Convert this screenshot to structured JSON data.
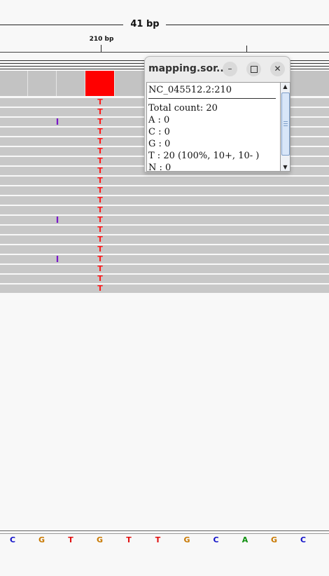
{
  "ruler": {
    "span_label": "41 bp",
    "position_label": "210 bp"
  },
  "reads": [
    {
      "base": "T",
      "insertion": ""
    },
    {
      "base": "T",
      "insertion": ""
    },
    {
      "base": "T",
      "insertion": "I"
    },
    {
      "base": "T",
      "insertion": ""
    },
    {
      "base": "T",
      "insertion": ""
    },
    {
      "base": "T",
      "insertion": ""
    },
    {
      "base": "T",
      "insertion": ""
    },
    {
      "base": "T",
      "insertion": ""
    },
    {
      "base": "T",
      "insertion": ""
    },
    {
      "base": "T",
      "insertion": ""
    },
    {
      "base": "T",
      "insertion": ""
    },
    {
      "base": "T",
      "insertion": ""
    },
    {
      "base": "T",
      "insertion": "I"
    },
    {
      "base": "T",
      "insertion": ""
    },
    {
      "base": "T",
      "insertion": ""
    },
    {
      "base": "T",
      "insertion": ""
    },
    {
      "base": "T",
      "insertion": "I"
    },
    {
      "base": "T",
      "insertion": ""
    },
    {
      "base": "T",
      "insertion": ""
    },
    {
      "base": "T",
      "insertion": ""
    }
  ],
  "popup": {
    "title": "mapping.sor...",
    "minimize_icon": "minimize-icon",
    "maximize_icon": "maximize-icon",
    "close_icon": "close-icon",
    "locus": "NC_045512.2:210",
    "lines": [
      "Total count: 20",
      "A : 0",
      "C : 0",
      "G : 0",
      "T : 20 (100%, 10+, 10- )",
      "N : 0"
    ]
  },
  "sequence": [
    {
      "base": "C",
      "color": "#1010c8"
    },
    {
      "base": "G",
      "color": "#c87800"
    },
    {
      "base": "T",
      "color": "#e01010"
    },
    {
      "base": "G",
      "color": "#c87800"
    },
    {
      "base": "T",
      "color": "#e01010"
    },
    {
      "base": "T",
      "color": "#e01010"
    },
    {
      "base": "G",
      "color": "#c87800"
    },
    {
      "base": "C",
      "color": "#1010c8"
    },
    {
      "base": "A",
      "color": "#109010"
    },
    {
      "base": "G",
      "color": "#c87800"
    },
    {
      "base": "C",
      "color": "#1010c8"
    }
  ],
  "colors": {
    "mismatch": "#ff1b1b",
    "insertion": "#7a18c8",
    "coverage_highlight": "#ff0000"
  }
}
